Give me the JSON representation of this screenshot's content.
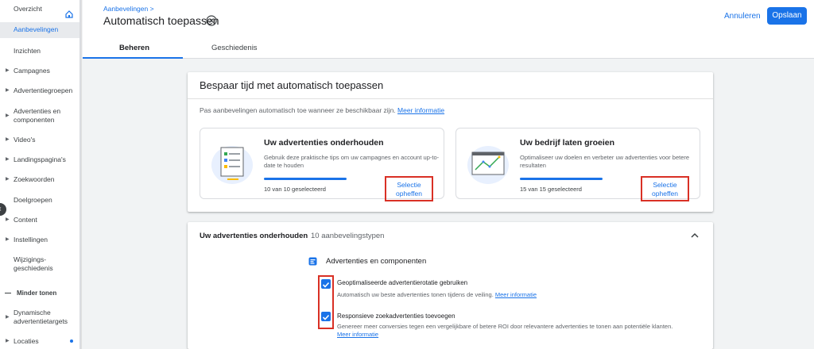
{
  "sidebar": {
    "items": [
      {
        "label": "Overzicht"
      },
      {
        "label": "Aanbevelingen"
      },
      {
        "label": "Inzichten"
      },
      {
        "label": "Campagnes"
      },
      {
        "label": "Advertentiegroepen"
      },
      {
        "label": "Advertenties en componenten"
      },
      {
        "label": "Video's"
      },
      {
        "label": "Landingspagina's"
      },
      {
        "label": "Zoekwoorden"
      },
      {
        "label": "Doelgroepen"
      },
      {
        "label": "Content"
      },
      {
        "label": "Instellingen"
      },
      {
        "label": "Wijzigings-geschiedenis"
      },
      {
        "label": "Minder tonen"
      },
      {
        "label": "Dynamische advertentietargets"
      },
      {
        "label": "Locaties"
      }
    ]
  },
  "header": {
    "breadcrumb": "Aanbevelingen",
    "title": "Automatisch toepassen",
    "cancel_label": "Annuleren",
    "save_label": "Opslaan",
    "tabs": [
      {
        "label": "Beheren"
      },
      {
        "label": "Geschiedenis"
      }
    ]
  },
  "card1": {
    "title": "Bespaar tijd met automatisch toepassen",
    "description": "Pas aanbevelingen automatisch toe wanneer ze beschikbaar zijn.",
    "learn_more": "Meer informatie",
    "subcards": [
      {
        "title": "Uw advertenties onderhouden",
        "description": "Gebruik deze praktische tips om uw campagnes en account up-to-date te houden",
        "count_label": "10 van 10 geselecteerd",
        "progress": 1.0,
        "action_line1": "Selectie",
        "action_line2": "opheffen"
      },
      {
        "title": "Uw bedrijf laten groeien",
        "description": "Optimaliseer uw doelen en verbeter uw advertenties voor betere resultaten",
        "count_label": "15 van 15 geselecteerd",
        "progress": 1.0,
        "action_line1": "Selectie",
        "action_line2": "opheffen"
      }
    ]
  },
  "card2": {
    "title": "Uw advertenties onderhouden",
    "count": "10 aanbevelingstypen",
    "section_title": "Advertenties en componenten",
    "options": [
      {
        "title": "Geoptimaliseerde advertentierotatie gebruiken",
        "description": "Automatisch uw beste advertenties tonen tijdens de veiling.",
        "learn_more": "Meer informatie",
        "checked": true
      },
      {
        "title": "Responsieve zoekadvertenties toevoegen",
        "description": "Genereer meer conversies tegen een vergelijkbare of betere ROI door relevantere advertenties te tonen aan potentiële klanten.",
        "learn_more": "Meer informatie",
        "checked": true
      }
    ]
  },
  "colors": {
    "accent": "#1a73e8",
    "highlight": "#d93025"
  }
}
